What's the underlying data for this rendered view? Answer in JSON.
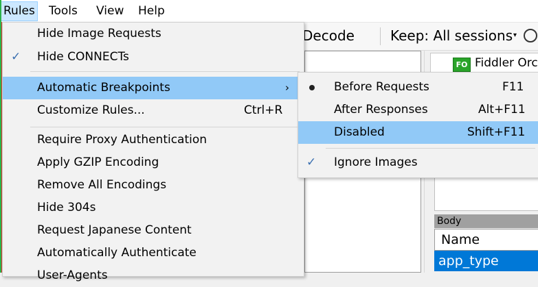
{
  "menubar": {
    "items": [
      "Rules",
      "Tools",
      "View",
      "Help"
    ]
  },
  "toolbar": {
    "decode_label": "Decode",
    "keep_label": "Keep: All sessions",
    "keep_arrow": "▾"
  },
  "inspector": {
    "fo_badge": "FO",
    "fo_tab_label": "Fiddler Orc",
    "body_header": "Body",
    "name_header": "Name",
    "selected_row": "app_type"
  },
  "rules_menu": {
    "items": [
      {
        "label": "Hide Image Requests",
        "checked": false
      },
      {
        "label": "Hide CONNECTs",
        "checked": true,
        "check_glyph": "✓"
      },
      {
        "label": "Automatic Breakpoints",
        "submenu_arrow": "›",
        "highlighted": true
      },
      {
        "label": "Customize Rules...",
        "shortcut": "Ctrl+R"
      },
      {
        "label": "Require Proxy Authentication"
      },
      {
        "label": "Apply GZIP Encoding"
      },
      {
        "label": "Remove All Encodings"
      },
      {
        "label": "Hide 304s"
      },
      {
        "label": "Request Japanese Content"
      },
      {
        "label": "Automatically Authenticate"
      },
      {
        "label": "User-Agents"
      }
    ]
  },
  "breakpoints_menu": {
    "items": [
      {
        "label": "Before Requests",
        "shortcut": "F11",
        "selected": true
      },
      {
        "label": "After Responses",
        "shortcut": "Alt+F11"
      },
      {
        "label": "Disabled",
        "shortcut": "Shift+F11",
        "highlighted": true
      },
      {
        "label": "Ignore Images",
        "checked": true,
        "check_glyph": "✓"
      }
    ]
  },
  "colors": {
    "highlight": "#91c9f7",
    "selection": "#0078d7",
    "menu_bg": "#f2f2f2"
  }
}
